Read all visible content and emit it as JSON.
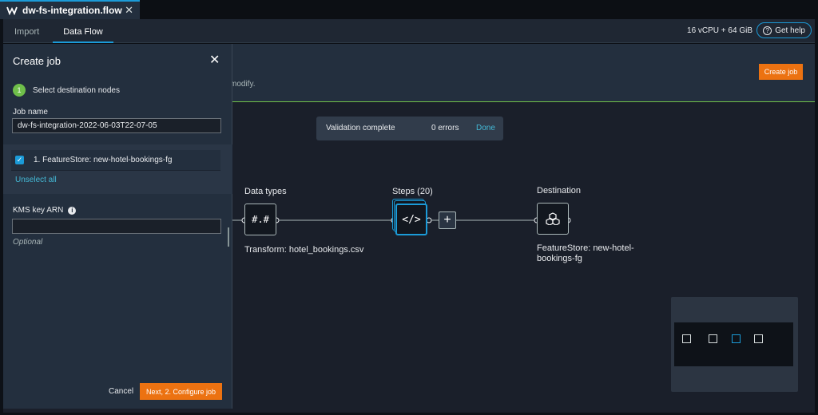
{
  "window": {
    "file_tab": "dw-fs-integration.flow",
    "close_symbol": "✕",
    "logo_icon": "data-wrangler-logo-icon"
  },
  "subnav": {
    "tabs": [
      {
        "label": "Import",
        "active": false
      },
      {
        "label": "Data Flow",
        "active": true
      }
    ],
    "resources": "16 vCPU + 64 GiB",
    "help_label": "Get help"
  },
  "header": {
    "modify_text": "modify.",
    "create_job_label": "Create job"
  },
  "validation": {
    "status": "Validation complete",
    "errors": "0 errors",
    "done_label": "Done"
  },
  "flow": {
    "data_types": {
      "title": "Data types",
      "glyph": "#.#",
      "caption": "Transform: hotel_bookings.csv"
    },
    "steps": {
      "title": "Steps (20)",
      "glyph": "</>"
    },
    "add_symbol": "+",
    "destination": {
      "title": "Destination",
      "caption_line1": "FeatureStore: new-hotel-",
      "caption_line2": "bookings-fg"
    }
  },
  "panel": {
    "title": "Create job",
    "close_symbol": "✕",
    "step_number": "1",
    "step_label": "Select destination nodes",
    "job_name_label": "Job name",
    "job_name_value": "dw-fs-integration-2022-06-03T22-07-05",
    "destinations": [
      {
        "label": "1. FeatureStore: new-hotel-bookings-fg",
        "checked": true
      }
    ],
    "unselect_all": "Unselect all",
    "kms_label": "KMS key ARN",
    "kms_value": "",
    "optional_label": "Optional",
    "cancel_label": "Cancel",
    "next_label": "Next, 2. Configure job"
  },
  "colors": {
    "accent_blue": "#1b9bd8",
    "primary_orange": "#ec7211",
    "success_green": "#6fbf4a",
    "link_blue": "#44b9d6"
  }
}
